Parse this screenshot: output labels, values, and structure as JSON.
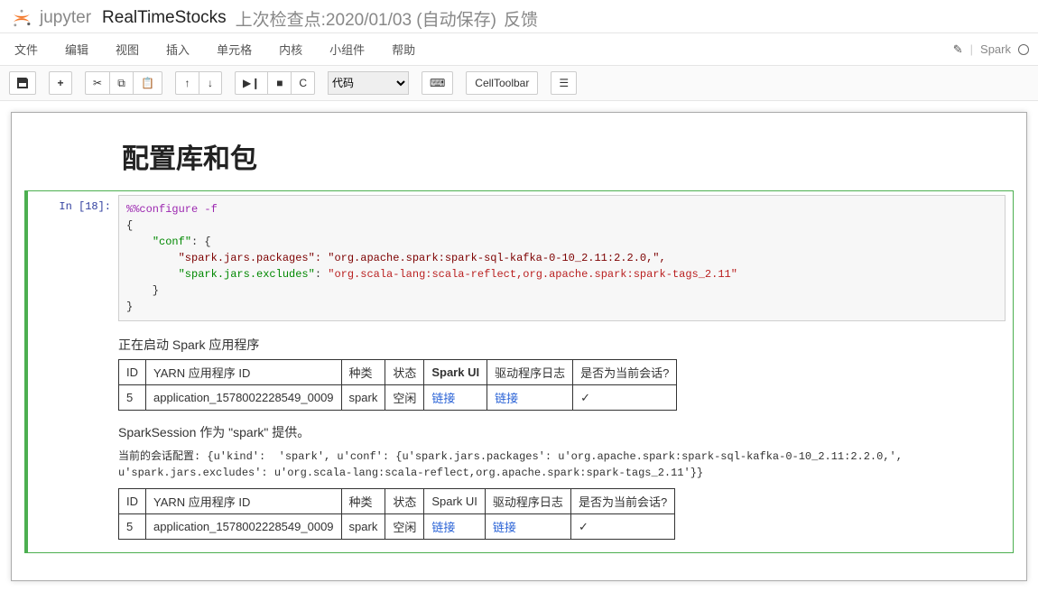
{
  "header": {
    "brand": "jupyter",
    "notebook_name": "RealTimeStocks",
    "checkpoint": "上次检查点:2020/01/03 (自动保存)",
    "feedback": "反馈"
  },
  "menus": {
    "file": "文件",
    "edit": "编辑",
    "view": "视图",
    "insert": "插入",
    "cell": "单元格",
    "kernel": "内核",
    "widgets": "小组件",
    "help": "帮助",
    "kernel_name": "Spark"
  },
  "toolbar": {
    "cell_type": "代码",
    "keyboard": "⌨",
    "celltoolbar": "CellToolbar",
    "cmd": "☰"
  },
  "markdown": {
    "title": "配置库和包"
  },
  "cell1": {
    "prompt": "In [18]:",
    "code": {
      "line1": "%%configure -f",
      "line2": "{",
      "key_conf": "\"conf\"",
      "colon_brace": ": {",
      "key_pkg": "\"spark.jars.packages\": \"org.apache.spark:spark-sql-kafka-0-10_2.11:2.2.0,\",",
      "key_excl": "\"spark.jars.excludes\"",
      "val_excl": "\"org.scala-lang:scala-reflect,org.apache.spark:spark-tags_2.11\"",
      "close1": "    }",
      "close2": "}"
    },
    "out": {
      "starting": "正在启动 Spark 应用程序",
      "t1": {
        "h_id": "ID",
        "h_yarn": "YARN 应用程序 ID",
        "h_kind": "种类",
        "h_state": "状态",
        "h_ui": "Spark UI",
        "h_log": "驱动程序日志",
        "h_current": "是否为当前会话?",
        "id": "5",
        "yarn": "application_1578002228549_0009",
        "kind": "spark",
        "state": "空闲",
        "link": "链接",
        "check": "✓"
      },
      "session": "SparkSession 作为 \"spark\" 提供。",
      "config_prefix": "当前的会话配置: {u'kind':",
      "config_rest": "  'spark', u'conf': {u'spark.jars.packages': u'org.apache.spark:spark-sql-kafka-0-10_2.11:2.2.0,', u'spark.jars.excludes': u'org.scala-lang:scala-reflect,org.apache.spark:spark-tags_2.11'}}",
      "t2": {
        "h_id": "ID",
        "h_yarn": "YARN 应用程序 ID",
        "h_kind": "种类",
        "h_state": "状态",
        "h_ui": "Spark UI",
        "h_log": "驱动程序日志",
        "h_current": "是否为当前会话?",
        "id": "5",
        "yarn": "application_1578002228549_0009",
        "kind": "spark",
        "state": "空闲",
        "link": "链接",
        "check": "✓"
      }
    }
  }
}
